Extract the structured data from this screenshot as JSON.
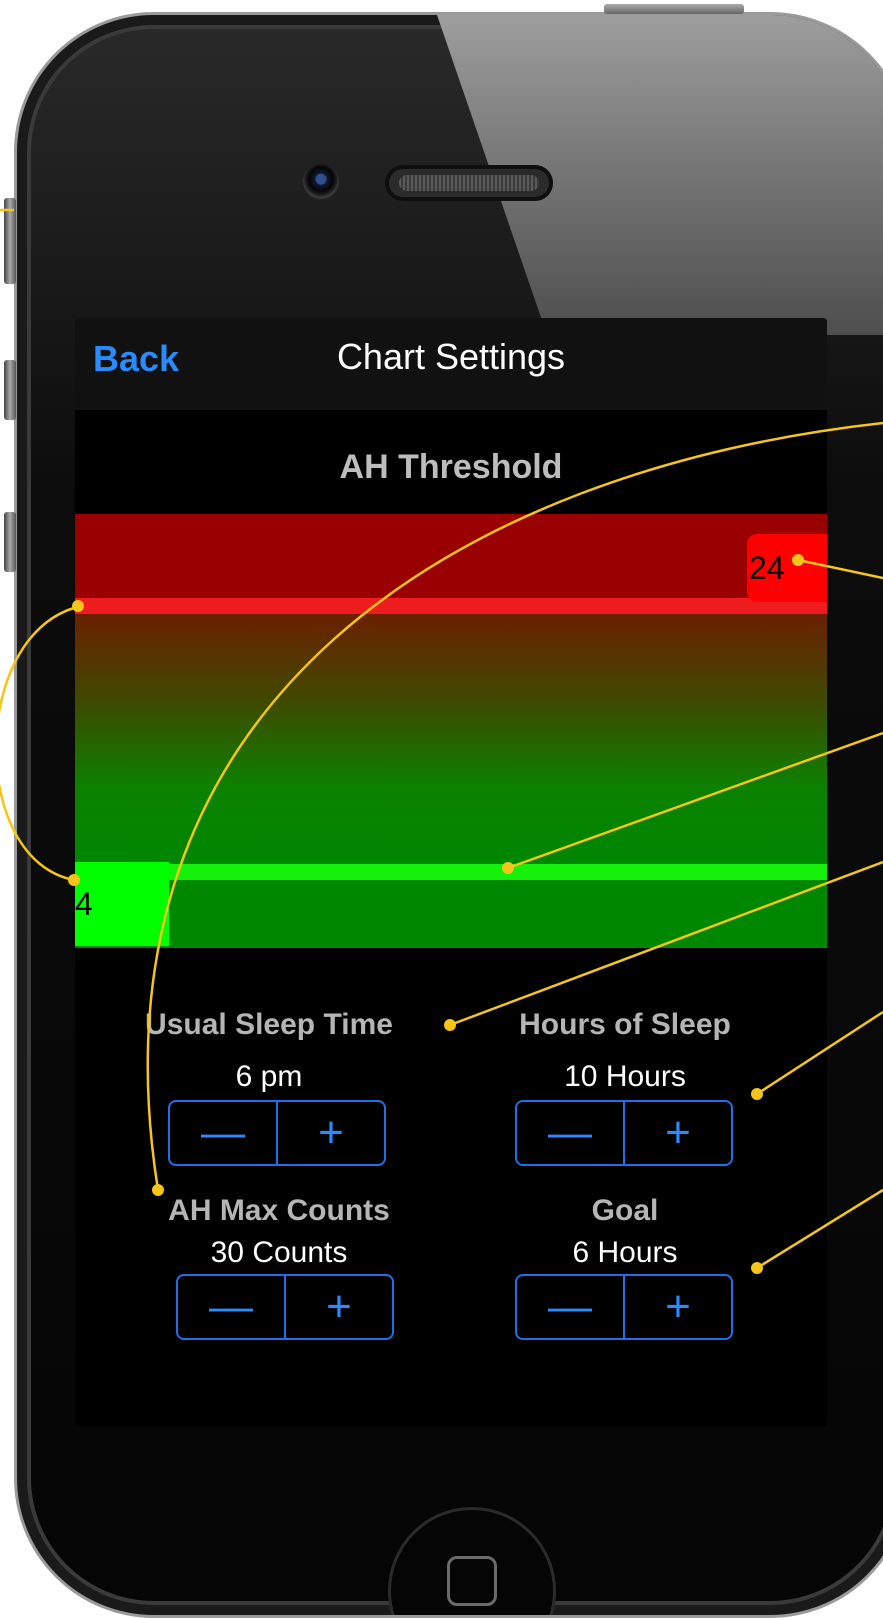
{
  "nav": {
    "back_label": "Back",
    "title": "Chart Settings"
  },
  "threshold": {
    "title": "AH Threshold",
    "upper_value": "24",
    "lower_value": "4"
  },
  "controls": {
    "sleep_time": {
      "label": "Usual Sleep Time",
      "value": "6 pm",
      "minus": "—",
      "plus": "+"
    },
    "hours_sleep": {
      "label": "Hours of Sleep",
      "value": "10 Hours",
      "minus": "—",
      "plus": "+"
    },
    "max_counts": {
      "label": "AH Max Counts",
      "value": "30 Counts",
      "minus": "—",
      "plus": "+"
    },
    "goal": {
      "label": "Goal",
      "value": "6 Hours",
      "minus": "—",
      "plus": "+"
    }
  },
  "colors": {
    "accent": "#2a8bff",
    "danger_zone": "#990000",
    "danger_line": "#ee1c1c",
    "safe_zone": "#008700",
    "safe_line": "#15f10b",
    "annotation": "#f5c518"
  },
  "icons": {
    "home": "home-button-icon",
    "camera": "front-camera-icon"
  }
}
